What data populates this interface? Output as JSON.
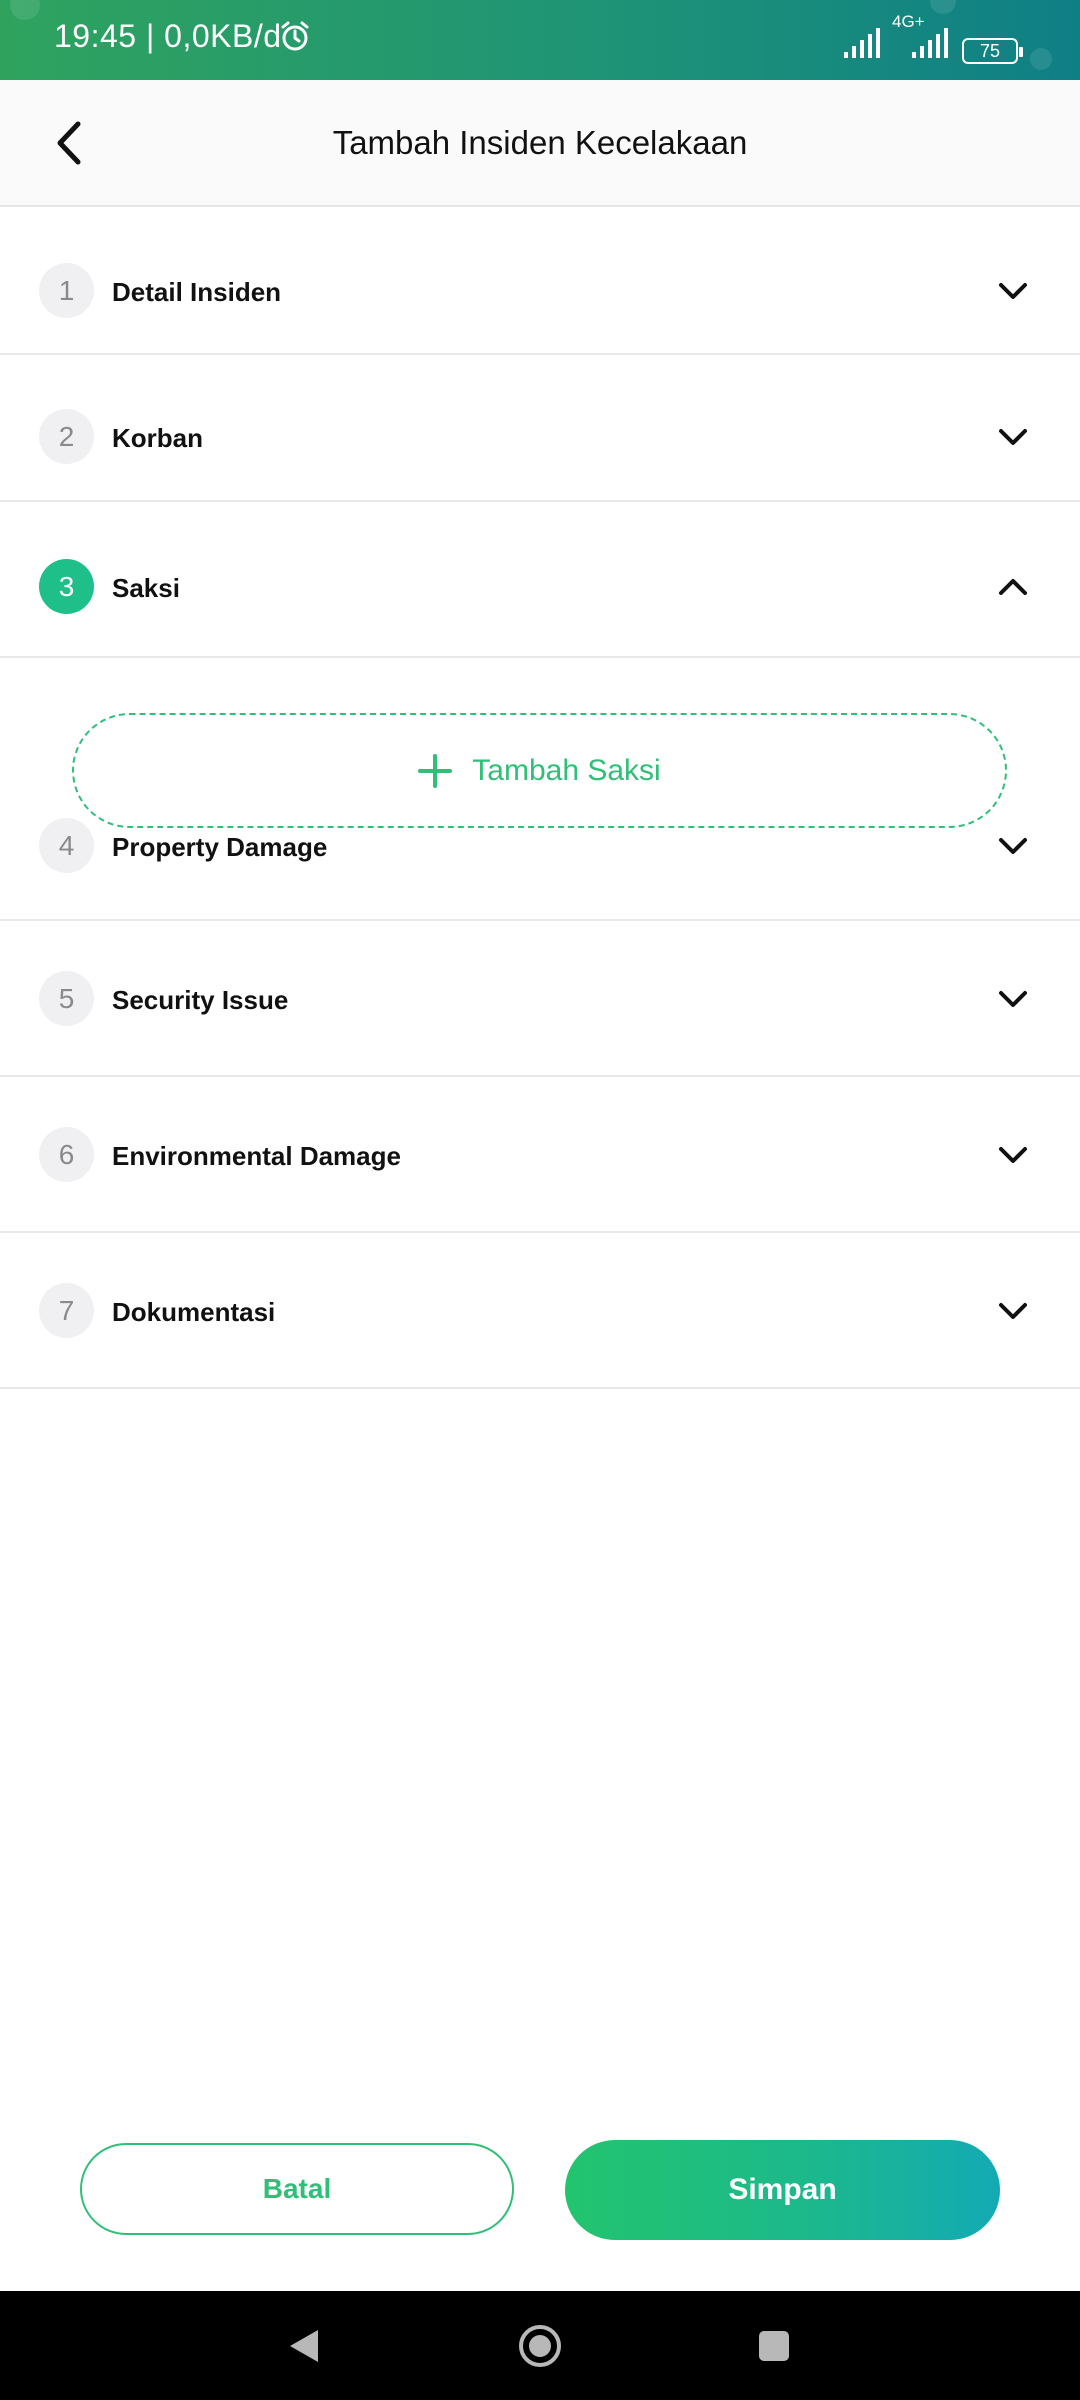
{
  "status_bar": {
    "time": "19:45",
    "speed": "0,0KB/d",
    "network": "4G+",
    "battery": "75"
  },
  "header": {
    "title": "Tambah Insiden Kecelakaan"
  },
  "sections": [
    {
      "number": "1",
      "title": "Detail Insiden",
      "expanded": false
    },
    {
      "number": "2",
      "title": "Korban",
      "expanded": false
    },
    {
      "number": "3",
      "title": "Saksi",
      "expanded": true
    },
    {
      "number": "4",
      "title": "Property Damage",
      "expanded": false
    },
    {
      "number": "5",
      "title": "Security Issue",
      "expanded": false
    },
    {
      "number": "6",
      "title": "Environmental Damage",
      "expanded": false
    },
    {
      "number": "7",
      "title": "Dokumentasi",
      "expanded": false
    }
  ],
  "add_witness": {
    "label": "Tambah Saksi"
  },
  "actions": {
    "cancel_label": "Batal",
    "save_label": "Simpan"
  },
  "colors": {
    "accent": "#2fbf77",
    "active_step": "#1fbf8a",
    "save_gradient_end": "#13aab4"
  }
}
